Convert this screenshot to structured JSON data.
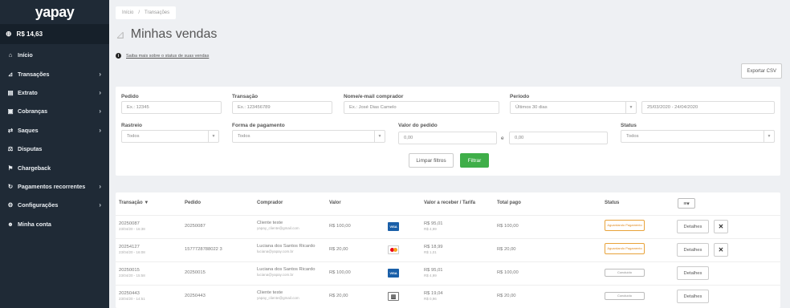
{
  "sidebar": {
    "logo": "yapay",
    "balance": "R$ 14,63",
    "items": [
      {
        "icon": "home-icon",
        "glyph": "⌂",
        "label": "Início",
        "chevron": ""
      },
      {
        "icon": "chart-icon",
        "glyph": "⊿",
        "label": "Transações",
        "chevron": "›"
      },
      {
        "icon": "document-icon",
        "glyph": "▤",
        "label": "Extrato",
        "chevron": "›"
      },
      {
        "icon": "cobranca-icon",
        "glyph": "▣",
        "label": "Cobranças",
        "chevron": "›"
      },
      {
        "icon": "withdraw-icon",
        "glyph": "⇄",
        "label": "Saques",
        "chevron": "›"
      },
      {
        "icon": "dispute-icon",
        "glyph": "⚖",
        "label": "Disputas",
        "chevron": ""
      },
      {
        "icon": "chargeback-icon",
        "glyph": "⚑",
        "label": "Chargeback",
        "chevron": ""
      },
      {
        "icon": "recurring-icon",
        "glyph": "↻",
        "label": "Pagamentos recorrentes",
        "chevron": "›"
      },
      {
        "icon": "gear-icon",
        "glyph": "⚙",
        "label": "Configurações",
        "chevron": "›"
      },
      {
        "icon": "user-icon",
        "glyph": "☻",
        "label": "Minha conta",
        "chevron": ""
      }
    ]
  },
  "breadcrumb": {
    "home": "Início",
    "separator": "/",
    "current": "Transações"
  },
  "page_title": "Minhas vendas",
  "help_link": "Saiba mais sobre o status de suas vendas",
  "export_button": "Exportar CSV",
  "filters": {
    "pedido_label": "Pedido",
    "pedido_placeholder": "Ex.: 12345",
    "transacao_label": "Transação",
    "transacao_placeholder": "Ex.: 123456789",
    "nome_label": "Nome/e-mail comprador",
    "nome_placeholder": "Ex.: José Dias Camelo",
    "periodo_label": "Período",
    "periodo_value": "Últimos 30 dias",
    "periodo_range": "25/03/2020 - 24/04/2020",
    "rastreio_label": "Rastreio",
    "rastreio_value": "Todos",
    "forma_label": "Forma de pagamento",
    "forma_value": "Todos",
    "valor_label": "Valor do pedido",
    "valor_min": "0,00",
    "valor_e": "e",
    "valor_max": "0,00",
    "status_label": "Status",
    "status_value": "Todos",
    "clear_button": "Limpar filtros",
    "filter_button": "Filtrar"
  },
  "table": {
    "headers": {
      "transacao": "Transação ▼",
      "pedido": "Pedido",
      "comprador": "Comprador",
      "valor": "Valor",
      "receber": "Valor a receber / Tarifa",
      "total": "Total pago",
      "status": "Status"
    },
    "rows": [
      {
        "id": "20250087",
        "date": "23/04/20 - 16:38",
        "pedido": "20250087",
        "buyer": "Cliente teste",
        "email": "yapay_cliente@gmail.com",
        "valor": "R$ 100,00",
        "card": "VISA",
        "receber": "R$ 95,01",
        "tarifa": "R$ 4,99",
        "total": "R$ 100,00",
        "status": "Aguardando Pagamento",
        "status_type": "pending",
        "details": "Detalhes",
        "cancel": "✕"
      },
      {
        "id": "20254127",
        "date": "23/04/20 - 16:08",
        "pedido": "1577728788022 3",
        "buyer": "Luciana dos Santos Ricardo",
        "email": "luciana@yapay.com.br",
        "valor": "R$ 20,00",
        "card": "MASTER",
        "receber": "R$ 18,99",
        "tarifa": "R$ 1,01",
        "total": "R$ 20,00",
        "status": "Aguardando Pagamento",
        "status_type": "pending",
        "details": "Detalhes",
        "cancel": "✕"
      },
      {
        "id": "20250015",
        "date": "23/04/20 - 15:58",
        "pedido": "20250015",
        "buyer": "Luciana dos Santos Ricardo",
        "email": "luciana@yapay.com.br",
        "valor": "R$ 100,00",
        "card": "VISA",
        "receber": "R$ 95,01",
        "tarifa": "R$ 4,99",
        "total": "R$ 100,00",
        "status": "Concluído",
        "status_type": "done",
        "details": "Detalhes",
        "cancel": ""
      },
      {
        "id": "20250443",
        "date": "23/04/20 - 14:51",
        "pedido": "20250443",
        "buyer": "Cliente teste",
        "email": "yapay_cliente@gmail.com",
        "valor": "R$ 20,00",
        "card": "BOLETO",
        "receber": "R$ 19,04",
        "tarifa": "R$ 0,96",
        "total": "R$ 20,00",
        "status": "Concluído",
        "status_type": "done",
        "details": "Detalhes",
        "cancel": ""
      }
    ]
  },
  "colors": {
    "sidebar": "#1f2a36",
    "accent_green": "#3fae49",
    "pending": "#e8a23a"
  }
}
